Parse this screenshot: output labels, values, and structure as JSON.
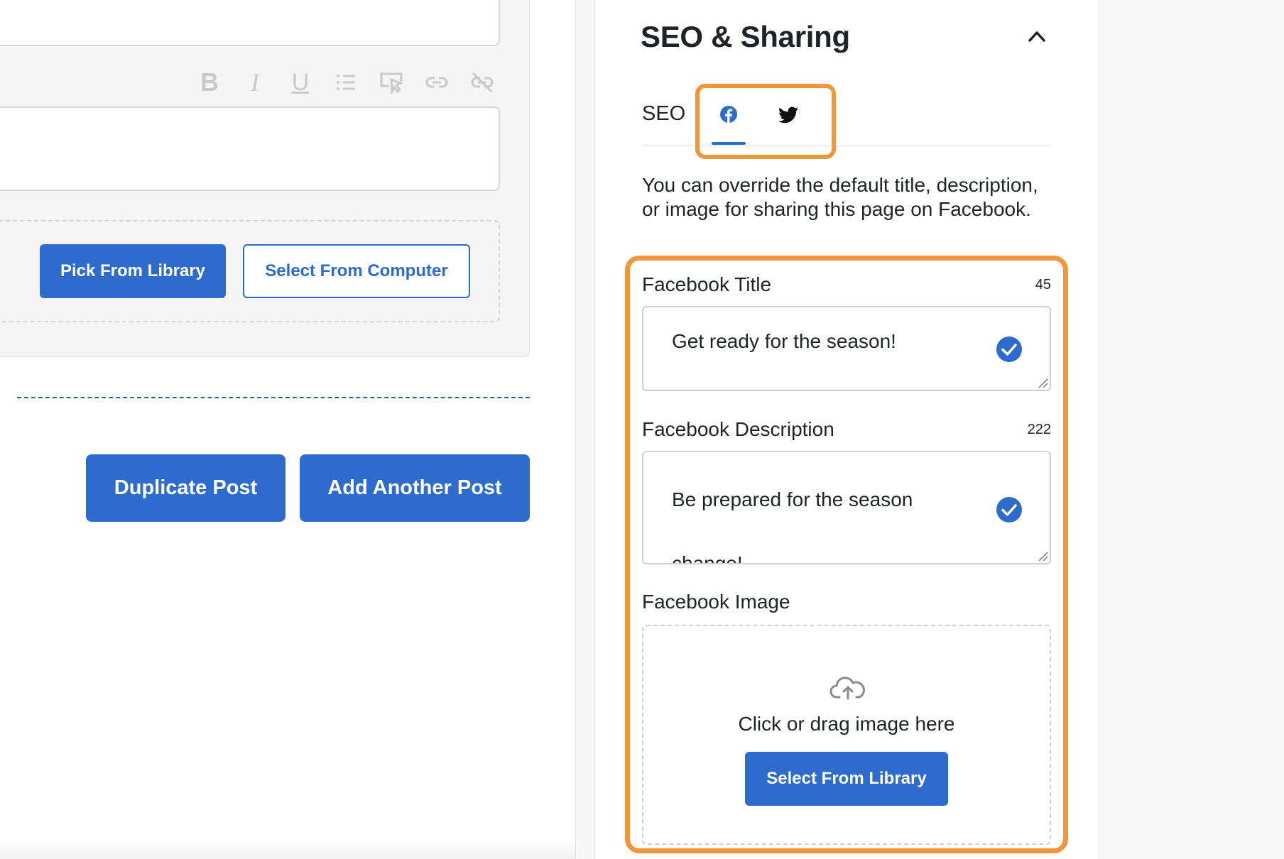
{
  "editor": {
    "toolbar": {
      "bold": "B",
      "italic": "I",
      "underline": "U"
    },
    "upload": {
      "pick_library_label": "Pick From Library",
      "select_computer_label": "Select From Computer"
    },
    "actions": {
      "duplicate_label": "Duplicate Post",
      "add_another_label": "Add Another Post"
    }
  },
  "seo_panel": {
    "title": "SEO & Sharing",
    "tabs": {
      "seo_label": "SEO",
      "facebook_icon": "facebook-icon",
      "twitter_icon": "twitter-icon",
      "active": "facebook"
    },
    "intro": "You can override the default title, description, or image for sharing this page on Facebook.",
    "facebook_title": {
      "label": "Facebook Title",
      "count": "45",
      "value": "Get ready for the season!"
    },
    "facebook_description": {
      "label": "Facebook Description",
      "count": "222",
      "value": "Be prepared for the season change!"
    },
    "facebook_image": {
      "label": "Facebook Image",
      "drop_text": "Click or drag image here",
      "select_library_label": "Select From Library"
    }
  },
  "colors": {
    "accent": "#2d6ccd",
    "highlight": "#f0973b",
    "text": "#1f2328"
  }
}
